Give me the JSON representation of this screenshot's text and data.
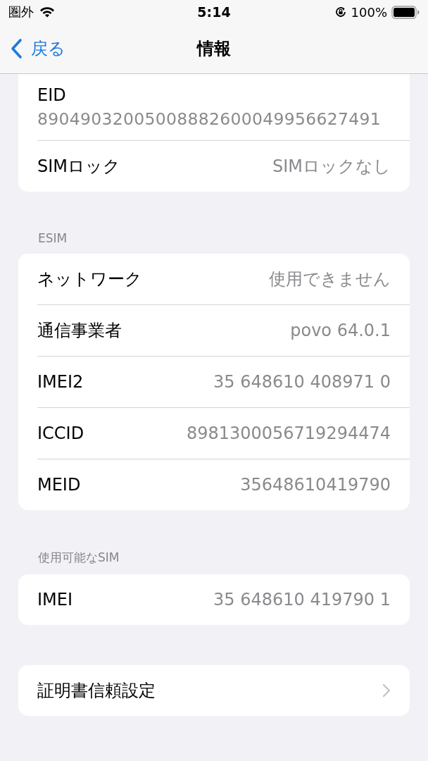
{
  "status_bar": {
    "carrier": "圏外",
    "time": "5:14",
    "battery": "100%"
  },
  "nav": {
    "back": "戻る",
    "title": "情報"
  },
  "sections": [
    {
      "rows": [
        {
          "kind": "stacked",
          "label": "EID",
          "value": "89049032005008882600049956627491"
        },
        {
          "kind": "value",
          "label": "SIMロック",
          "value": "SIMロックなし"
        }
      ]
    },
    {
      "header": "ESIM",
      "rows": [
        {
          "kind": "value",
          "label": "ネットワーク",
          "value": "使用できません"
        },
        {
          "kind": "value",
          "label": "通信事業者",
          "value": "povo 64.0.1"
        },
        {
          "kind": "value",
          "label": "IMEI2",
          "value": "35 648610 408971 0"
        },
        {
          "kind": "value",
          "label": "ICCID",
          "value": "8981300056719294474"
        },
        {
          "kind": "value",
          "label": "MEID",
          "value": "35648610419790"
        }
      ]
    },
    {
      "header": "使用可能なSIM",
      "rows": [
        {
          "kind": "value",
          "label": "IMEI",
          "value": "35 648610 419790 1"
        }
      ]
    },
    {
      "rows": [
        {
          "kind": "link",
          "label": "証明書信頼設定"
        }
      ]
    }
  ]
}
